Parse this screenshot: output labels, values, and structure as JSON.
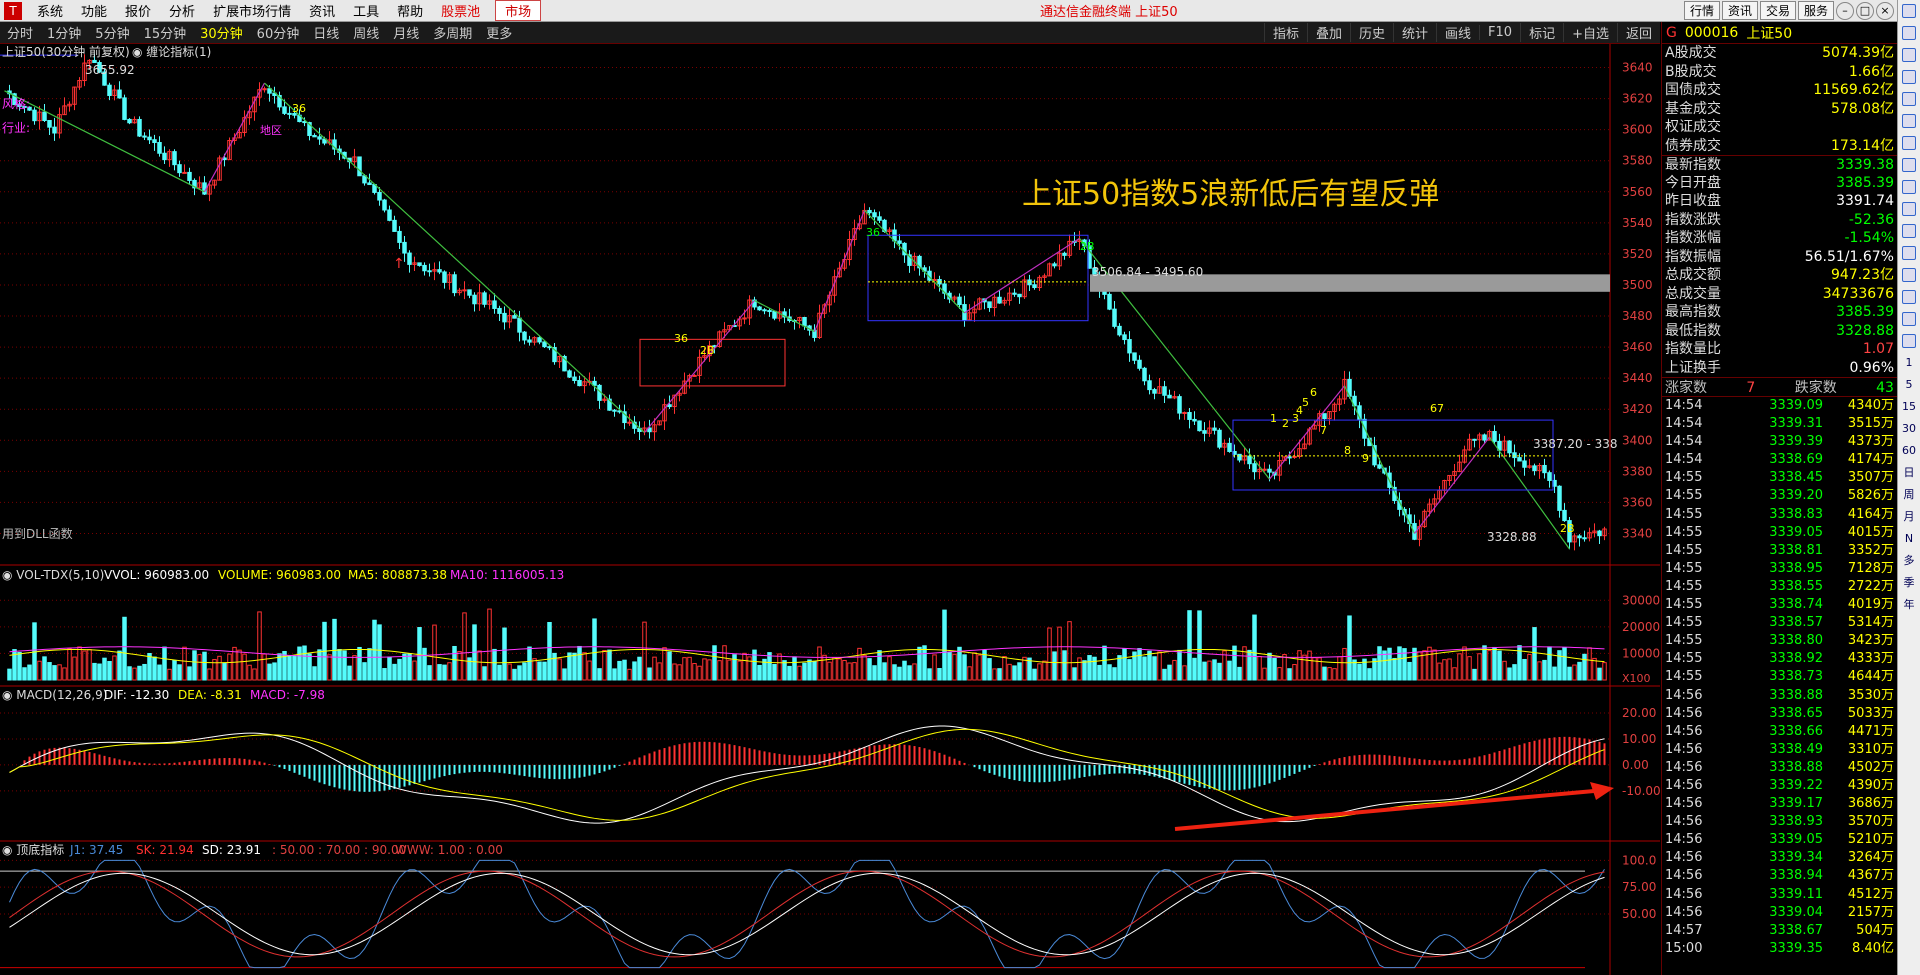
{
  "menubar": {
    "items": [
      "系统",
      "功能",
      "报价",
      "分析",
      "扩展市场行情",
      "资讯",
      "工具",
      "帮助"
    ],
    "stock_pool": "股票池",
    "market": "市场",
    "title": "通达信金融终端 上证50",
    "right_buttons": [
      "行情",
      "资讯",
      "交易",
      "服务"
    ]
  },
  "timeframes": [
    "分时",
    "1分钟",
    "5分钟",
    "15分钟",
    "30分钟",
    "60分钟",
    "日线",
    "周线",
    "月线",
    "多周期",
    "更多"
  ],
  "active_timeframe": "30分钟",
  "toolbar": [
    "指标",
    "叠加",
    "历史",
    "统计",
    "画线",
    "F10",
    "标记",
    "+自选",
    "返回"
  ],
  "main_chart": {
    "label": "上证50(30分钟 前复权)",
    "indicator": "缠论指标(1)",
    "headline": "上证50指数5浪新低后有望反弹",
    "high_marker": "3655.92",
    "range_label": "3506.84 - 3495.60",
    "level_label": "3387.20 - 338",
    "low_marker": "3328.88",
    "bottom_left": "用到DLL函数",
    "y_ticks": [
      "3640",
      "3620",
      "3600",
      "3580",
      "3560",
      "3540",
      "3520",
      "3500",
      "3480",
      "3460",
      "3440",
      "3420",
      "3400",
      "3380",
      "3360",
      "3340"
    ],
    "left_tags": [
      "风格:",
      "行业:"
    ],
    "annotations": [
      "36",
      "地区",
      "36",
      "2B",
      "36",
      "2B",
      "1",
      "2",
      "3",
      "4",
      "5",
      "6",
      "7",
      "8",
      "9",
      "67",
      "2B"
    ]
  },
  "vol_panel": {
    "name": "VOL-TDX(5,10)",
    "vvol": "VVOL: 960983.00",
    "volume": "VOLUME: 960983.00",
    "ma5": "MA5: 808873.38",
    "ma10": "MA10: 1116005.13",
    "y_ticks": [
      "30000",
      "20000",
      "10000"
    ],
    "unit": "X100"
  },
  "macd_panel": {
    "name": "MACD(12,26,9)",
    "dif": "DIF: -12.30",
    "dea": "DEA: -8.31",
    "macd": "MACD: -7.98",
    "y_ticks": [
      "20.00",
      "10.00",
      "0.00",
      "-10.00"
    ]
  },
  "kd_panel": {
    "name": "顶底指标",
    "j1": "J1: 37.45",
    "sk": "SK: 21.94",
    "sd": "SD: 23.91",
    "levels": ": 50.00 : 70.00 : 90.00",
    "ww": "WWW: 1.00 : 0.00",
    "y_ticks": [
      "100.0",
      "75.00",
      "50.00"
    ]
  },
  "right_panel": {
    "code": "000016",
    "name": "上证50",
    "stats": [
      [
        "A股成交",
        "5074.39亿",
        "ye"
      ],
      [
        "B股成交",
        "1.66亿",
        "ye"
      ],
      [
        "国债成交",
        "11569.62亿",
        "ye"
      ],
      [
        "基金成交",
        "578.08亿",
        "ye"
      ],
      [
        "权证成交",
        "",
        ""
      ],
      [
        "债券成交",
        "173.14亿",
        "ye"
      ],
      [
        "最新指数",
        "3339.38",
        "gr"
      ],
      [
        "今日开盘",
        "3385.39",
        "gr"
      ],
      [
        "昨日收盘",
        "3391.74",
        "wh"
      ],
      [
        "指数涨跌",
        "-52.36",
        "gr"
      ],
      [
        "指数涨幅",
        "-1.54%",
        "gr"
      ],
      [
        "指数振幅",
        "56.51/1.67%",
        "wh"
      ],
      [
        "总成交额",
        "947.23亿",
        "ye"
      ],
      [
        "总成交量",
        "34733676",
        "ye"
      ],
      [
        "最高指数",
        "3385.39",
        "gr"
      ],
      [
        "最低指数",
        "3328.88",
        "gr"
      ],
      [
        "指数量比",
        "1.07",
        "rd"
      ],
      [
        "上证换手",
        "0.96%",
        "wh"
      ]
    ],
    "updown": {
      "up_label": "涨家数",
      "up": "7",
      "down_label": "跌家数",
      "down": "43"
    },
    "ticks": [
      [
        "14:54",
        "3339.09",
        "4340万"
      ],
      [
        "14:54",
        "3339.31",
        "3515万"
      ],
      [
        "14:54",
        "3339.39",
        "4373万"
      ],
      [
        "14:54",
        "3338.69",
        "4174万"
      ],
      [
        "14:55",
        "3338.45",
        "3507万"
      ],
      [
        "14:55",
        "3339.20",
        "5826万"
      ],
      [
        "14:55",
        "3338.83",
        "4164万"
      ],
      [
        "14:55",
        "3339.05",
        "4015万"
      ],
      [
        "14:55",
        "3338.81",
        "3352万"
      ],
      [
        "14:55",
        "3338.95",
        "7128万"
      ],
      [
        "14:55",
        "3338.55",
        "2722万"
      ],
      [
        "14:55",
        "3338.74",
        "4019万"
      ],
      [
        "14:55",
        "3338.57",
        "5314万"
      ],
      [
        "14:55",
        "3338.80",
        "3423万"
      ],
      [
        "14:55",
        "3338.92",
        "4333万"
      ],
      [
        "14:55",
        "3338.73",
        "4644万"
      ],
      [
        "14:56",
        "3338.88",
        "3530万"
      ],
      [
        "14:56",
        "3338.65",
        "5033万"
      ],
      [
        "14:56",
        "3338.66",
        "4471万"
      ],
      [
        "14:56",
        "3338.49",
        "3310万"
      ],
      [
        "14:56",
        "3338.88",
        "4502万"
      ],
      [
        "14:56",
        "3339.22",
        "4390万"
      ],
      [
        "14:56",
        "3339.17",
        "3686万"
      ],
      [
        "14:56",
        "3338.93",
        "3570万"
      ],
      [
        "14:56",
        "3339.05",
        "5210万"
      ],
      [
        "14:56",
        "3339.34",
        "3264万"
      ],
      [
        "14:56",
        "3338.94",
        "4367万"
      ],
      [
        "14:56",
        "3339.11",
        "4512万"
      ],
      [
        "14:56",
        "3339.04",
        "2157万"
      ],
      [
        "14:57",
        "3338.67",
        "504万"
      ],
      [
        "15:00",
        "3339.35",
        "8.40亿"
      ]
    ]
  },
  "sidebar": [
    "1",
    "5",
    "15",
    "30",
    "60",
    "日",
    "周",
    "月",
    "N",
    "多",
    "季",
    "年"
  ],
  "colors": {
    "up": "#ff3232",
    "down": "#54fcfc",
    "grid": "#7a0000",
    "text_yellow": "#ffff00",
    "headline": "#f2c40a"
  }
}
